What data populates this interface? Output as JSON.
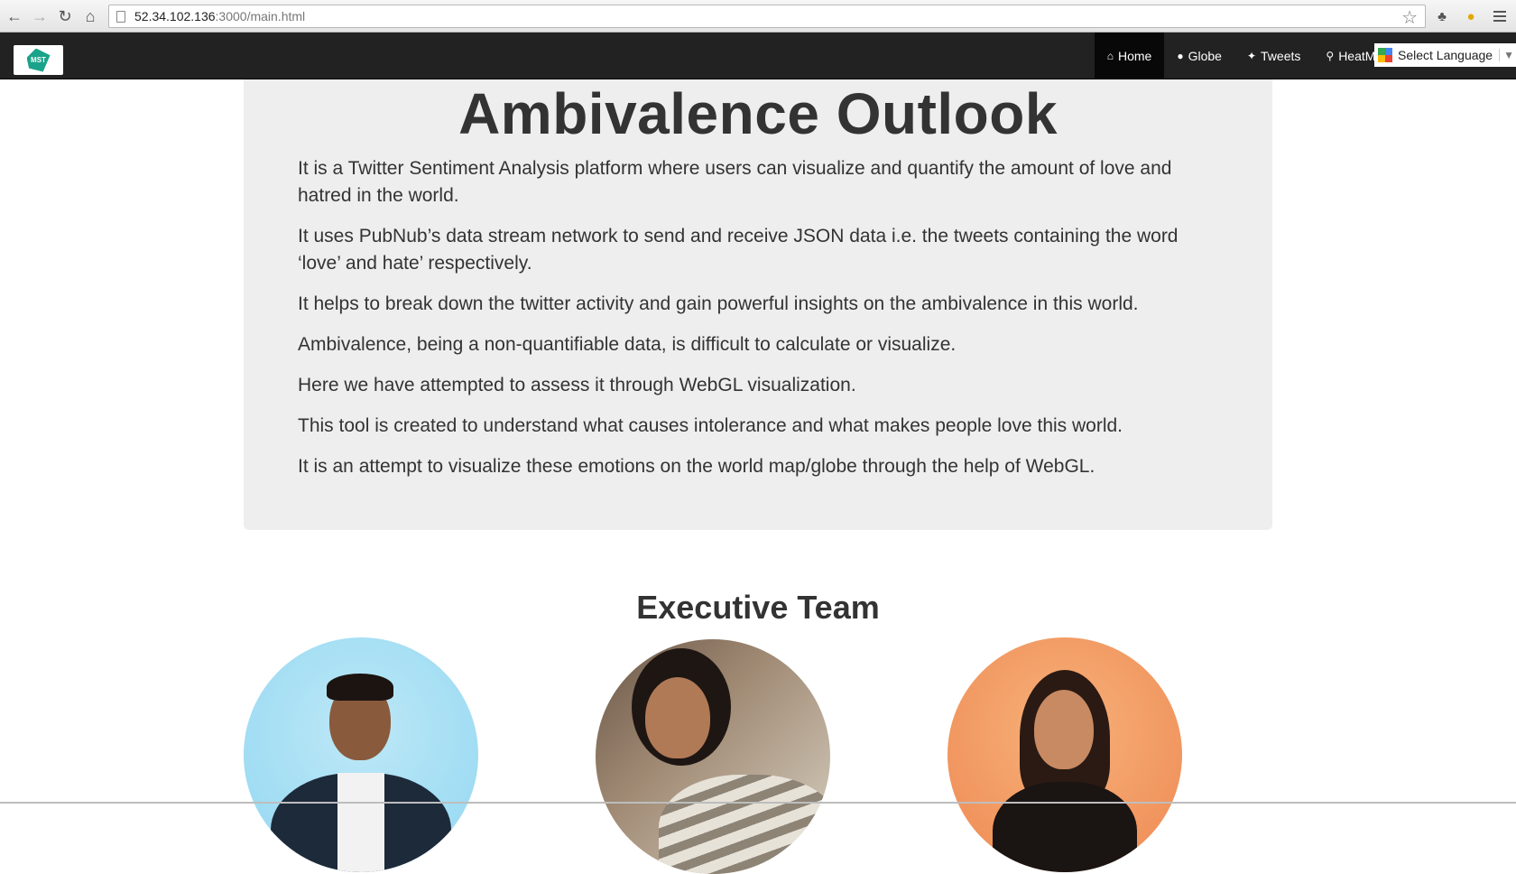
{
  "browser": {
    "url_host": "52.34.102.136",
    "url_rest": ":3000/main.html"
  },
  "navbar": {
    "logo_text": "MST",
    "items": [
      {
        "label": "Home",
        "icon": "home-icon",
        "active": true
      },
      {
        "label": "Globe",
        "icon": "globe-icon",
        "active": false
      },
      {
        "label": "Tweets",
        "icon": "twitter-icon",
        "active": false
      },
      {
        "label": "HeatMap",
        "icon": "map-marker-icon",
        "active": false
      }
    ],
    "language_select": "Select Language"
  },
  "jumbotron": {
    "title": "Ambivalence Outlook",
    "paragraphs": [
      "It is a Twitter Sentiment Analysis platform where users can visualize and quantify the amount of love and hatred in the world.",
      "It uses PubNub’s data stream network to send and receive JSON data i.e. the tweets containing the word ‘love’ and hate’ respectively.",
      "It helps to break down the twitter activity and gain powerful insights on the ambivalence in this world.",
      "Ambivalence, being a non-quantifiable data, is difficult to calculate or visualize.",
      "Here we have attempted to assess it through WebGL visualization.",
      "This tool is created to understand what causes intolerance and what makes people love this world.",
      "It is an attempt to visualize these emotions on the world map/globe through the help of WebGL."
    ]
  },
  "team": {
    "title": "Executive Team"
  },
  "colors": {
    "navbar_bg": "#222222",
    "navbar_active": "#080808",
    "jumbotron_bg": "#eeeeee",
    "text": "#333333"
  }
}
